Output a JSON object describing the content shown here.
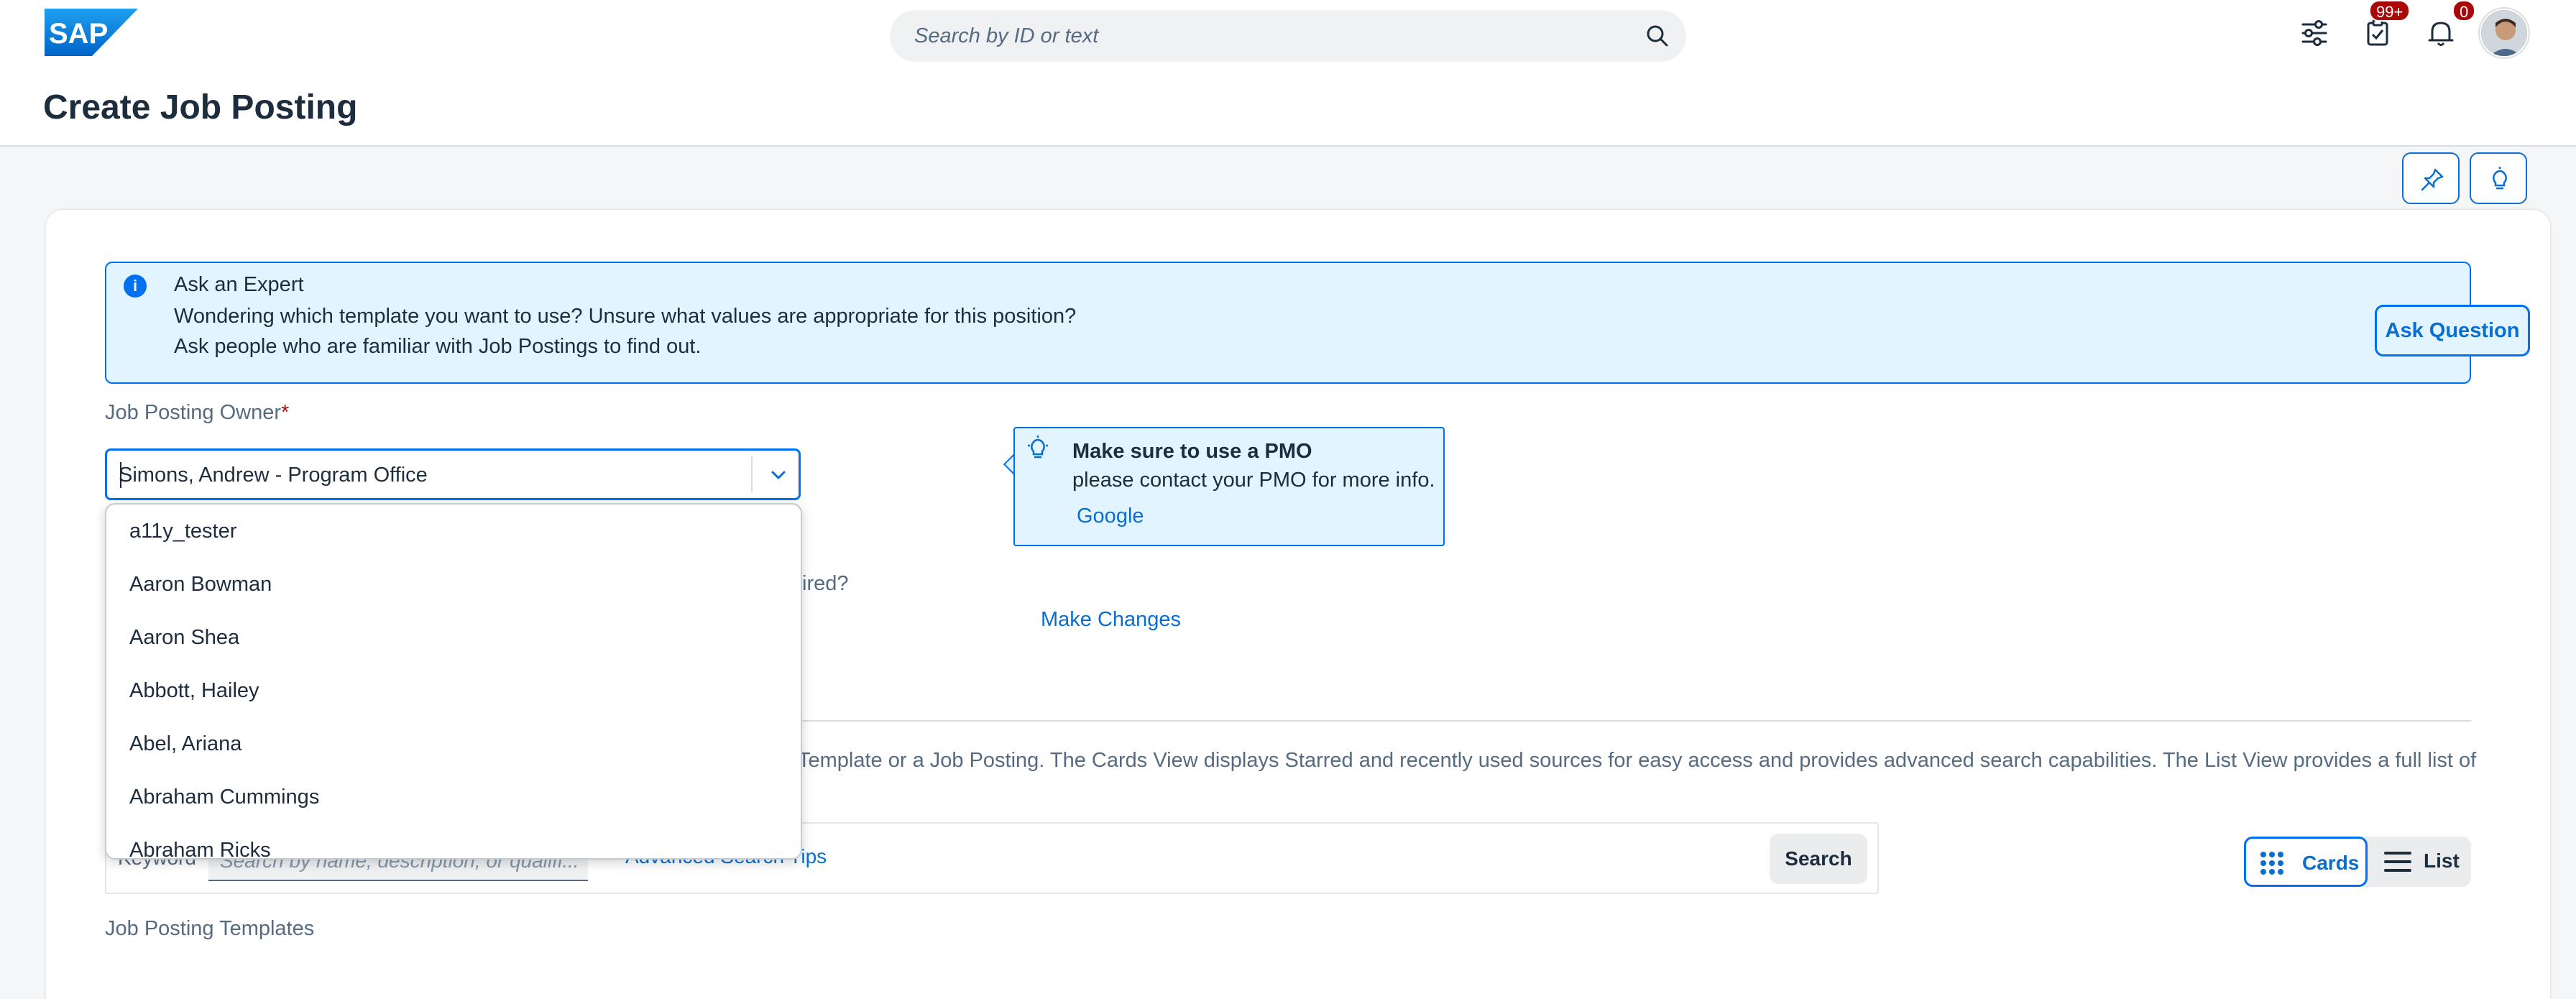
{
  "shell": {
    "logo_text": "SAP",
    "search_placeholder": "Search by ID or text",
    "todo_badge": "99+",
    "notification_badge": "0"
  },
  "page": {
    "title": "Create Job Posting"
  },
  "expert_strip": {
    "title": "Ask an Expert",
    "line1": "Wondering which template you want to use? Unsure what values are appropriate for this position?",
    "line2": "Ask people who are familiar with Job Postings to find out.",
    "button": "Ask Question"
  },
  "owner_field": {
    "label": "Job Posting Owner",
    "required_mark": "*",
    "value": "Simons, Andrew - Program Office"
  },
  "dropdown": {
    "items": [
      "a11y_tester",
      "Aaron Bowman",
      "Aaron Shea",
      "Abbott, Hailey",
      "Abel, Ariana",
      "Abraham Cummings",
      "Abraham Ricks"
    ]
  },
  "pmo_popover": {
    "title": "Make sure to use a PMO",
    "text": "please contact your PMO for more info.",
    "link": "Google"
  },
  "partial_question": "ired?",
  "make_changes": "Make Changes",
  "description": "Template or a Job Posting. The Cards View displays Starred and recently used sources for easy access and provides advanced search capabilities. The List View provides a full list of",
  "searchbar": {
    "keyword_label": "Keyword",
    "placeholder": "Search by name, description, or qualifi...",
    "advanced_tips": "Advanced Search Tips",
    "search_button": "Search"
  },
  "view_switch": {
    "cards": "Cards",
    "list": "List",
    "selected": "Cards"
  },
  "templates_label": "Job Posting Templates",
  "colors": {
    "brand_blue": "#0070f2",
    "strip_bg": "#e1f4ff",
    "badge_red": "#aa0808"
  }
}
